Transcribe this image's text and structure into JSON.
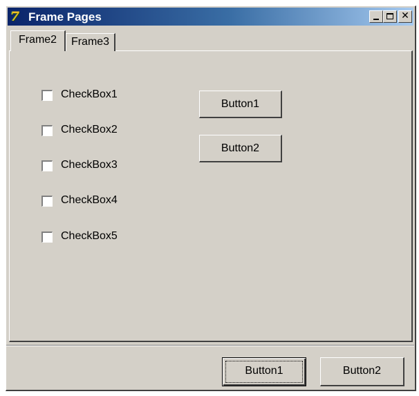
{
  "window": {
    "title": "Frame Pages",
    "app_icon_glyph": "7",
    "controls": {
      "minimize": "minimize-icon",
      "maximize": "maximize-icon",
      "close": "close-icon",
      "close_glyph": "✕"
    }
  },
  "tabs": [
    {
      "label": "Frame2",
      "active": true
    },
    {
      "label": "Frame3",
      "active": false
    }
  ],
  "panel": {
    "checkboxes": [
      {
        "label": "CheckBox1",
        "checked": false
      },
      {
        "label": "CheckBox2",
        "checked": false
      },
      {
        "label": "CheckBox3",
        "checked": false
      },
      {
        "label": "CheckBox4",
        "checked": false
      },
      {
        "label": "CheckBox5",
        "checked": false
      }
    ],
    "buttons": [
      {
        "label": "Button1"
      },
      {
        "label": "Button2"
      }
    ]
  },
  "footer": {
    "buttons": [
      {
        "label": "Button1",
        "default": true
      },
      {
        "label": "Button2",
        "default": false
      }
    ]
  },
  "colors": {
    "face": "#d4d0c8",
    "titlebar_start": "#0a246a",
    "titlebar_end": "#a6caf0",
    "title_text": "#ffffff"
  }
}
